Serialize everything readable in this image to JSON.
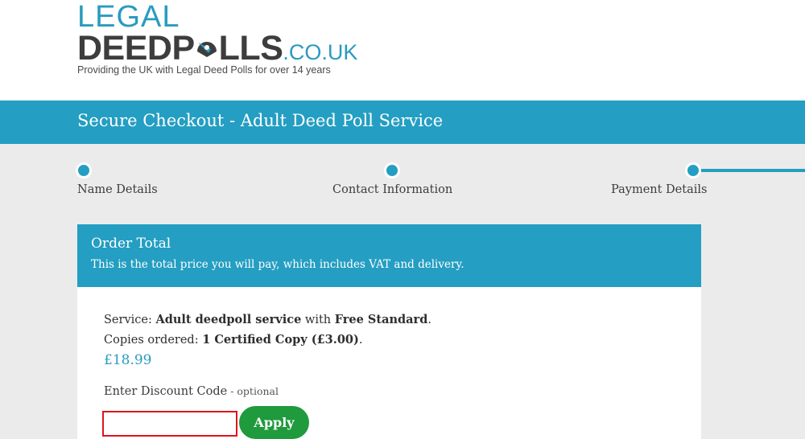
{
  "logo": {
    "line1": "LEGAL",
    "line2_a": "DEEDP",
    "line2_b": "LLS",
    "line2_tld": ".CO.UK",
    "tagline": "Providing the UK with Legal Deed Polls for over 14 years"
  },
  "page_title": "Secure Checkout - Adult Deed Poll Service",
  "steps": [
    {
      "label": "Name Details",
      "state": "complete"
    },
    {
      "label": "Contact Information",
      "state": "complete"
    },
    {
      "label": "Payment Details",
      "state": "current"
    }
  ],
  "order": {
    "title": "Order Total",
    "subtitle": "This is the total price you will pay, which includes VAT and delivery.",
    "service_prefix": "Service: ",
    "service_name": "Adult deedpoll service",
    "service_with": " with ",
    "delivery": "Free Standard",
    "service_end": ".",
    "copies_prefix": "Copies ordered: ",
    "copies_value": "1 Certified Copy (£3.00)",
    "copies_end": ".",
    "price": "£18.99"
  },
  "discount": {
    "label": "Enter Discount Code",
    "optional": " - optional",
    "value": "",
    "placeholder": "",
    "apply_label": "Apply"
  },
  "colors": {
    "brand_blue": "#249ec2",
    "apply_green": "#1f9a3c",
    "input_border_red": "#e0141b",
    "logo_dark": "#3d3d3d"
  }
}
